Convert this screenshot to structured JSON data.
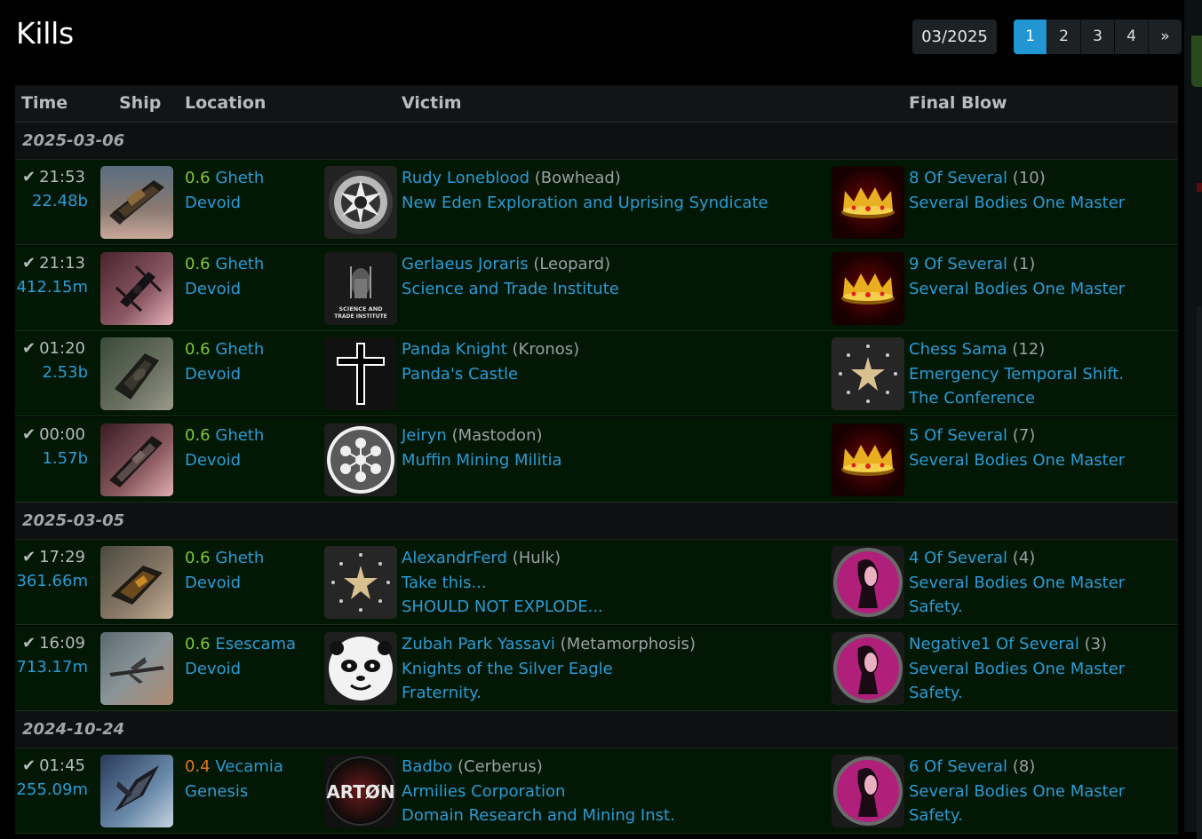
{
  "title": "Kills",
  "date_filter": "03/2025",
  "pagination": {
    "pages": [
      "1",
      "2",
      "3",
      "4"
    ],
    "next": "»",
    "active": "1"
  },
  "columns": {
    "time": "Time",
    "ship": "Ship",
    "location": "Location",
    "victim": "Victim",
    "final_blow": "Final Blow"
  },
  "groups": [
    {
      "date": "2025-03-06"
    },
    {
      "date": "2025-03-05"
    },
    {
      "date": "2024-10-24"
    }
  ],
  "kills": [
    {
      "time": "21:53",
      "value": "22.48b",
      "sec": "0.6",
      "system": "Gheth",
      "region": "Devoid",
      "victim_name": "Rudy Loneblood",
      "victim_ship": "(Bowhead)",
      "victim_corp": "New Eden Exploration and Uprising Syndicate",
      "victim_alliance": "",
      "fb_name": "8 Of Several",
      "fb_count": "(10)",
      "fb_corp": "Several Bodies One Master",
      "fb_alliance": ""
    },
    {
      "time": "21:13",
      "value": "412.15m",
      "sec": "0.6",
      "system": "Gheth",
      "region": "Devoid",
      "victim_name": "Gerlaeus Joraris",
      "victim_ship": "(Leopard)",
      "victim_corp": "Science and Trade Institute",
      "victim_alliance": "",
      "fb_name": "9 Of Several",
      "fb_count": "(1)",
      "fb_corp": "Several Bodies One Master",
      "fb_alliance": ""
    },
    {
      "time": "01:20",
      "value": "2.53b",
      "sec": "0.6",
      "system": "Gheth",
      "region": "Devoid",
      "victim_name": "Panda Knight",
      "victim_ship": "(Kronos)",
      "victim_corp": "Panda's Castle",
      "victim_alliance": "",
      "fb_name": "Chess Sama",
      "fb_count": "(12)",
      "fb_corp": "Emergency Temporal Shift.",
      "fb_alliance": "The Conference"
    },
    {
      "time": "00:00",
      "value": "1.57b",
      "sec": "0.6",
      "system": "Gheth",
      "region": "Devoid",
      "victim_name": "Jeiryn",
      "victim_ship": "(Mastodon)",
      "victim_corp": "Muffin Mining Militia",
      "victim_alliance": "",
      "fb_name": "5 Of Several",
      "fb_count": "(7)",
      "fb_corp": "Several Bodies One Master",
      "fb_alliance": ""
    },
    {
      "time": "17:29",
      "value": "361.66m",
      "sec": "0.6",
      "system": "Gheth",
      "region": "Devoid",
      "victim_name": "AlexandrFerd",
      "victim_ship": "(Hulk)",
      "victim_corp": "Take this...",
      "victim_alliance": "SHOULD NOT EXPLODE...",
      "fb_name": "4 Of Several",
      "fb_count": "(4)",
      "fb_corp": "Several Bodies One Master",
      "fb_alliance": "Safety."
    },
    {
      "time": "16:09",
      "value": "713.17m",
      "sec": "0.6",
      "system": "Esescama",
      "region": "Devoid",
      "victim_name": "Zubah Park Yassavi",
      "victim_ship": "(Metamorphosis)",
      "victim_corp": "Knights of the Silver Eagle",
      "victim_alliance": "Fraternity.",
      "fb_name": "Negative1 Of Several",
      "fb_count": "(3)",
      "fb_corp": "Several Bodies One Master",
      "fb_alliance": "Safety."
    },
    {
      "time": "01:45",
      "value": "255.09m",
      "sec": "0.4",
      "system": "Vecamia",
      "region": "Genesis",
      "victim_name": "Badbo",
      "victim_ship": "(Cerberus)",
      "victim_corp": "Armilies Corporation",
      "victim_alliance": "Domain Research and Mining Inst.",
      "fb_name": "6 Of Several",
      "fb_count": "(8)",
      "fb_corp": "Several Bodies One Master",
      "fb_alliance": "Safety."
    }
  ],
  "logo_text": {
    "sti": "SCIENCE AND TRADE INSTITUTE",
    "arton": "ARTØN"
  },
  "colors": {
    "link": "#2c9ad6",
    "sec_high": "#7ec63a",
    "sec_low": "#e07a1f",
    "row_bg": "#021704",
    "active_page": "#2196d3"
  }
}
